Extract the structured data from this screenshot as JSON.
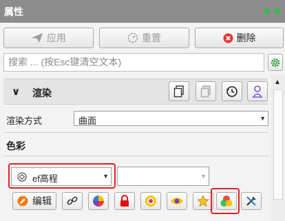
{
  "window": {
    "title": "属性"
  },
  "toolbar": {
    "apply_label": "应用",
    "reset_label": "重置",
    "delete_label": "删除"
  },
  "search": {
    "placeholder": "搜索 ... (按Esc键清空文本)"
  },
  "section": {
    "title": "渲染"
  },
  "render_mode": {
    "label": "渲染方式",
    "value": "曲面"
  },
  "color": {
    "heading": "色彩",
    "scalar_value": "ef高程",
    "secondary_value": "",
    "edit_label": "编辑"
  },
  "colors": {
    "accent_red": "#e02020",
    "delete_red": "#e03a3a",
    "edit_orange": "#f07a1a",
    "title_bar": "#8c8c8c"
  }
}
